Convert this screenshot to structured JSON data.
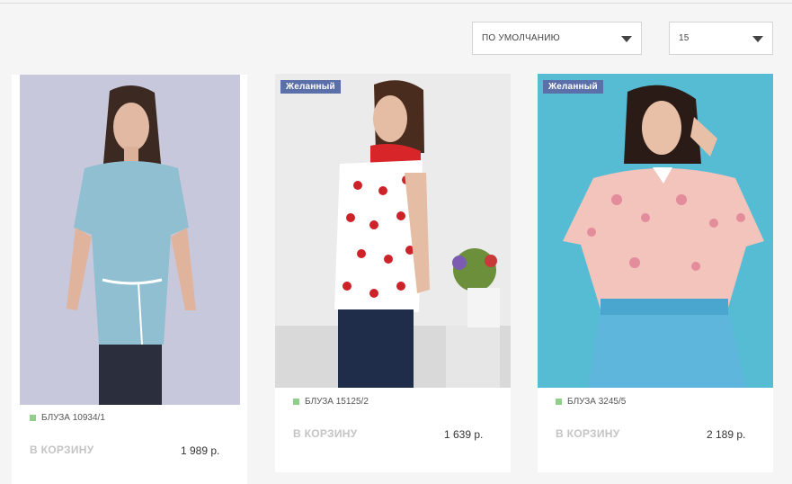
{
  "sorting": {
    "sort_value": "ПО УМОЛЧАНИЮ",
    "count_value": "15"
  },
  "products": [
    {
      "sku": "БЛУЗА 10934/1",
      "cart_label": "В КОРЗИНУ",
      "price": "1 989 р.",
      "badge": ""
    },
    {
      "sku": "БЛУЗА 15125/2",
      "cart_label": "В КОРЗИНУ",
      "price": "1 639 р.",
      "badge": "Желанный"
    },
    {
      "sku": "БЛУЗА 3245/5",
      "cart_label": "В КОРЗИНУ",
      "price": "2 189 р.",
      "badge": "Желанный"
    }
  ],
  "colors": {
    "badge_bg": "#5b6fa8",
    "in_stock_dot": "#8fcf8a",
    "cart_label": "#c4c4c4"
  }
}
